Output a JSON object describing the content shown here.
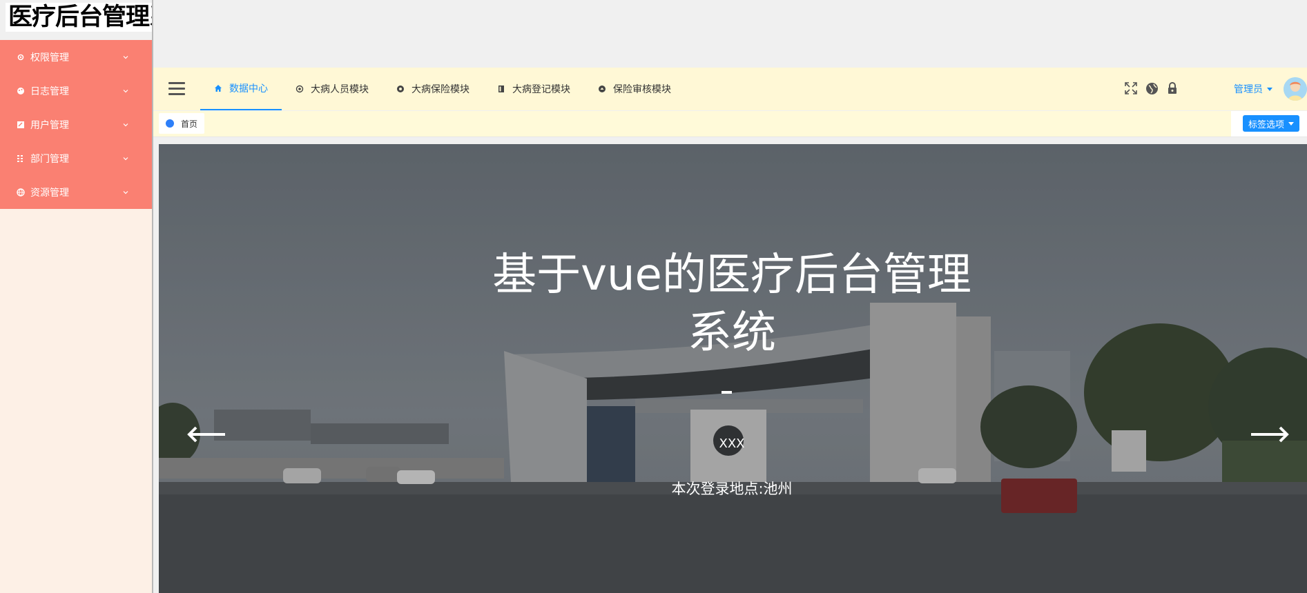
{
  "app": {
    "logo_text": "医疗后台管理系统"
  },
  "sidebar": {
    "items": [
      {
        "label": "权限管理",
        "icon": "gear-icon"
      },
      {
        "label": "日志管理",
        "icon": "palette-icon"
      },
      {
        "label": "用户管理",
        "icon": "edit-icon"
      },
      {
        "label": "部门管理",
        "icon": "grid-icon"
      },
      {
        "label": "资源管理",
        "icon": "globe-icon"
      }
    ]
  },
  "header": {
    "tabs": [
      {
        "label": "数据中心",
        "icon": "home-icon",
        "active": true
      },
      {
        "label": "大病人员模块",
        "icon": "settings-icon",
        "active": false
      },
      {
        "label": "大病保险模块",
        "icon": "shield-icon",
        "active": false
      },
      {
        "label": "大病登记模块",
        "icon": "book-icon",
        "active": false
      },
      {
        "label": "保险审核模块",
        "icon": "eject-icon",
        "active": false
      }
    ],
    "tools": [
      "fullscreen-icon",
      "globe-icon",
      "lock-icon"
    ],
    "user_name": "管理员"
  },
  "tags": {
    "items": [
      {
        "label": "首页"
      }
    ],
    "options_label": "标签选项"
  },
  "carousel": {
    "title": "基于vue的医疗后台管理系统",
    "dash": "-",
    "subtitle": "XXX",
    "location": "本次登录地点:池州"
  },
  "colors": {
    "sidebar_menu": "#fa8072",
    "sidebar_bg": "#fdf0e6",
    "header_bg": "#fff8d6",
    "accent": "#1890ff"
  }
}
